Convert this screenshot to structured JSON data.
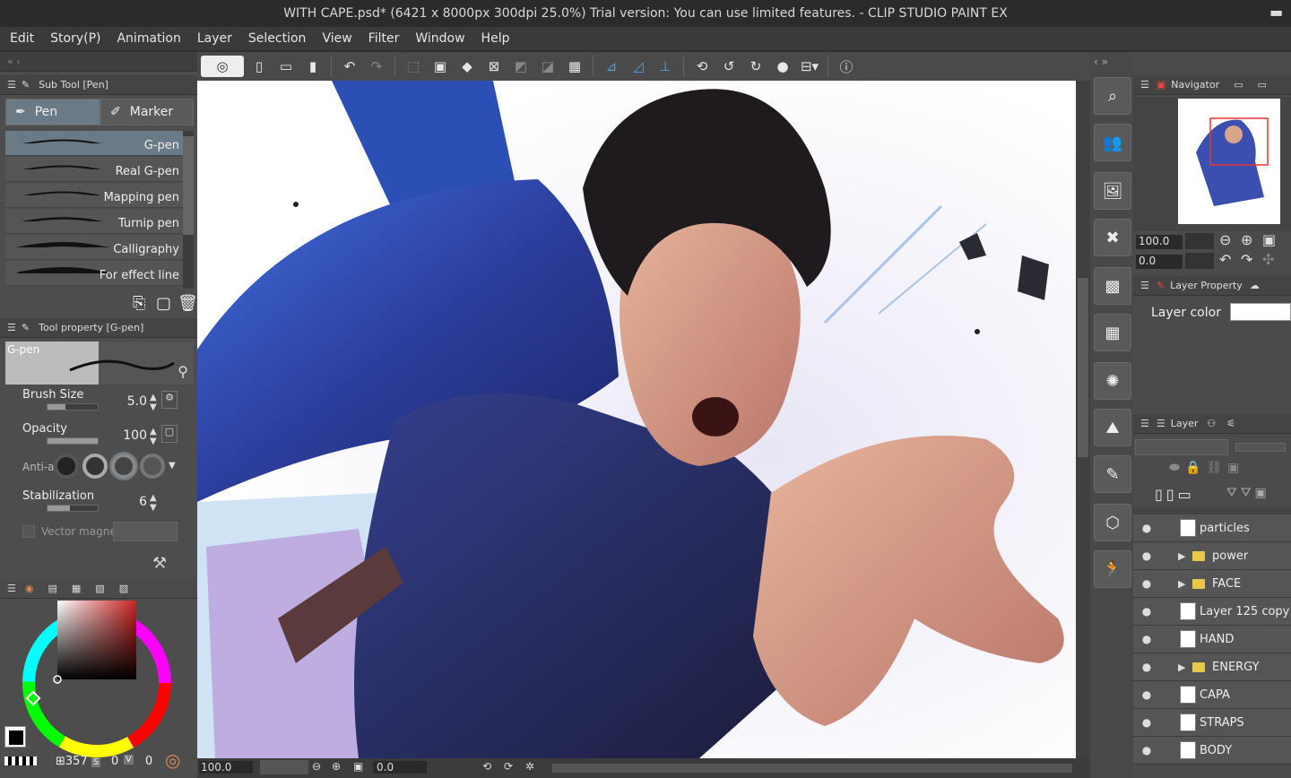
{
  "window": {
    "title": "WITH CAPE.psd* (6421 x 8000px 300dpi 25.0%)  Trial version: You can use limited features. - CLIP STUDIO PAINT EX"
  },
  "menu": [
    "Edit",
    "Story(P)",
    "Animation",
    "Layer",
    "Selection",
    "View",
    "Filter",
    "Window",
    "Help"
  ],
  "sub_tool": {
    "header": "Sub Tool [Pen]",
    "groups": [
      "Pen",
      "Marker"
    ],
    "brushes": [
      "G-pen",
      "Real G-pen",
      "Mapping pen",
      "Turnip pen",
      "Calligraphy",
      "For effect line"
    ],
    "selected_brush": "G-pen"
  },
  "tool_property": {
    "header": "Tool property [G-pen]",
    "preview_label": "G-pen",
    "brush_size_label": "Brush Size",
    "brush_size": "5.0",
    "brush_size_fill": 0.35,
    "opacity_label": "Opacity",
    "opacity": "100",
    "opacity_fill": 1.0,
    "anti_label": "Anti-a",
    "stabilization_label": "Stabilization",
    "stabilization": "6",
    "stabilization_fill": 0.45,
    "vector_label": "Vector magnet"
  },
  "color": {
    "main": "#000000",
    "sub": "#ffffff",
    "hue": "#cc2222",
    "h_value": "357",
    "s_value": "0",
    "v_value": "0",
    "h_label": "S",
    "v_label": "V"
  },
  "status": {
    "zoom": "100.0",
    "rotation": "0.0"
  },
  "navigator": {
    "header": "Navigator",
    "zoom": "100.0",
    "rotation": "0.0"
  },
  "layer_property": {
    "header": "Layer Property",
    "layer_color_label": "Layer color"
  },
  "layers": {
    "header": "Layer",
    "items": [
      {
        "name": "particles",
        "type": "layer"
      },
      {
        "name": "power",
        "type": "folder"
      },
      {
        "name": "FACE",
        "type": "folder"
      },
      {
        "name": "Layer 125 copy",
        "type": "layer"
      },
      {
        "name": "HAND",
        "type": "layer"
      },
      {
        "name": "ENERGY",
        "type": "folder"
      },
      {
        "name": "CAPA",
        "type": "layer"
      },
      {
        "name": "STRAPS",
        "type": "layer"
      },
      {
        "name": "BODY",
        "type": "layer"
      }
    ]
  },
  "colors": {
    "accent": "#4ea3e8",
    "selected_row": "#6a7a86",
    "panel": "#4d4d4d"
  }
}
